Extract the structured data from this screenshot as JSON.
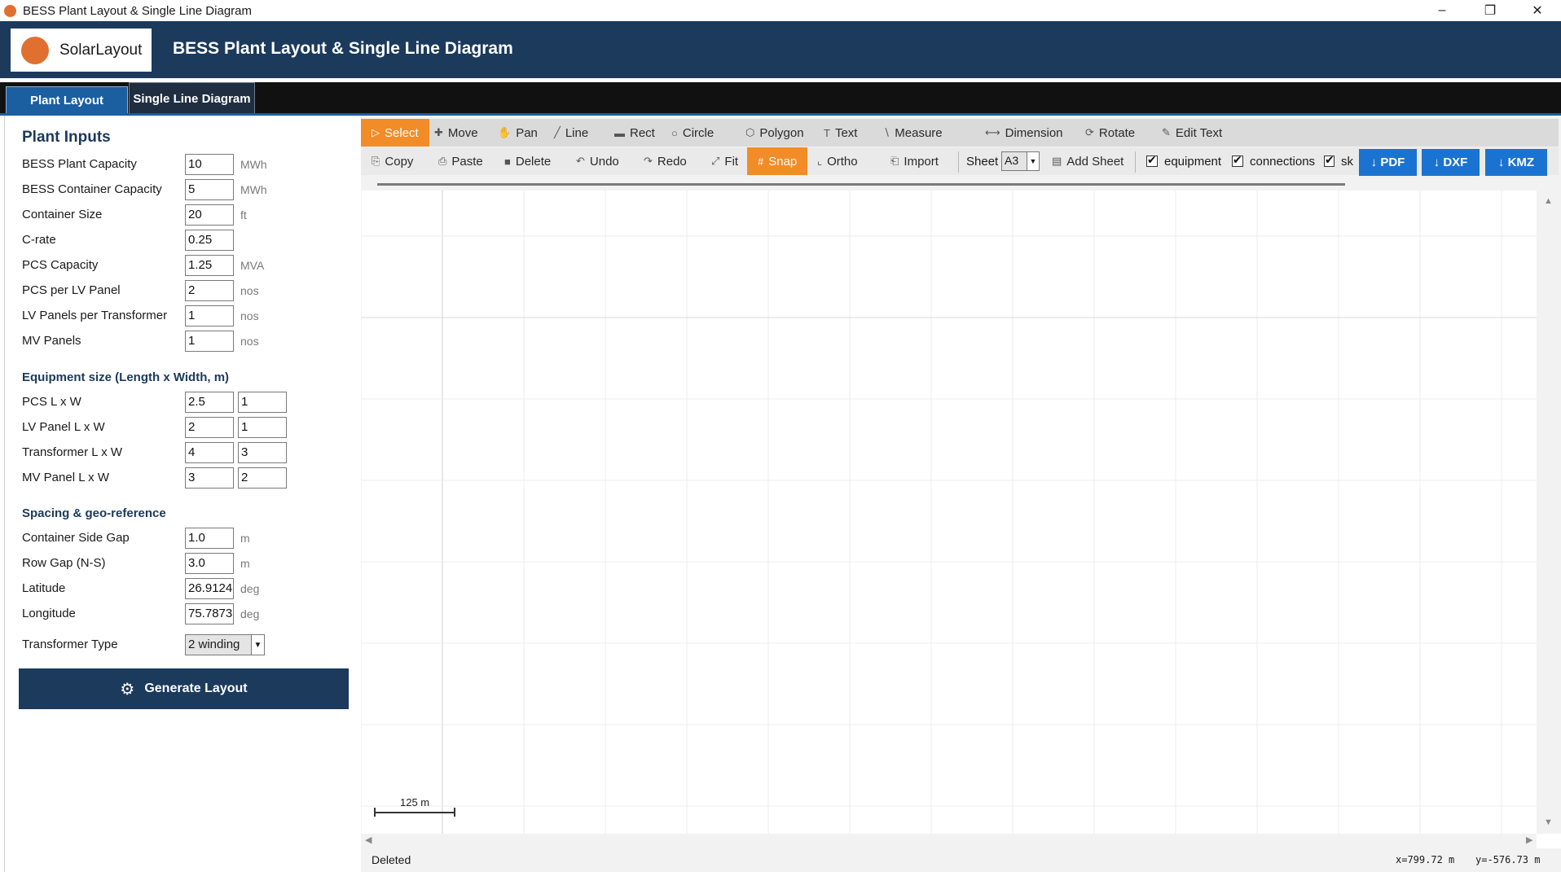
{
  "window": {
    "title": "BESS Plant Layout & Single Line Diagram",
    "minimize": "–",
    "maximize": "❐",
    "close": "✕"
  },
  "header": {
    "logo_text": "SolarLayout",
    "title": "BESS Plant Layout & Single Line Diagram"
  },
  "tabs": [
    {
      "label": "Plant Layout",
      "active": true
    },
    {
      "label": "Single Line Diagram",
      "active": false
    }
  ],
  "left": {
    "plant_inputs_title": "Plant Inputs",
    "plant_inputs": [
      {
        "label": "BESS Plant Capacity",
        "value": "10",
        "unit": "MWh"
      },
      {
        "label": "BESS Container Capacity",
        "value": "5",
        "unit": "MWh"
      },
      {
        "label": "Container Size",
        "value": "20",
        "unit": "ft"
      },
      {
        "label": "C-rate",
        "value": "0.25",
        "unit": ""
      },
      {
        "label": "PCS Capacity",
        "value": "1.25",
        "unit": "MVA"
      },
      {
        "label": "PCS per LV Panel",
        "value": "2",
        "unit": "nos"
      },
      {
        "label": "LV Panels per Transformer",
        "value": "1",
        "unit": "nos"
      },
      {
        "label": "MV Panels",
        "value": "1",
        "unit": "nos"
      }
    ],
    "equip_title": "Equipment size  (Length x Width, m)",
    "equipment": [
      {
        "label": "PCS  L x W",
        "length": "2.5",
        "width": "1"
      },
      {
        "label": "LV Panel  L x W",
        "length": "2",
        "width": "1"
      },
      {
        "label": "Transformer  L x W",
        "length": "4",
        "width": "3"
      },
      {
        "label": "MV Panel  L x W",
        "length": "3",
        "width": "2"
      }
    ],
    "spacing_title": "Spacing & geo-reference",
    "spacing": [
      {
        "label": "Container Side Gap",
        "value": "1.0",
        "unit": "m"
      },
      {
        "label": "Row Gap (N-S)",
        "value": "3.0",
        "unit": "m"
      },
      {
        "label": "Latitude",
        "value": "26.9124",
        "unit": "deg"
      },
      {
        "label": "Longitude",
        "value": "75.7873",
        "unit": "deg"
      }
    ],
    "transformer_type_label": "Transformer Type",
    "transformer_type_value": "2 winding",
    "generate_label": "Generate Layout"
  },
  "toolbar1": [
    {
      "label": "Select",
      "icon": "▷",
      "name": "select",
      "active": true
    },
    {
      "label": "Move",
      "icon": "✚",
      "name": "move"
    },
    {
      "label": "Pan",
      "icon": "✋",
      "name": "pan"
    },
    {
      "label": "Line",
      "icon": "╱",
      "name": "line"
    },
    {
      "label": "Rect",
      "icon": "▬",
      "name": "rect"
    },
    {
      "label": "Circle",
      "icon": "○",
      "name": "circle"
    },
    {
      "label": "Polygon",
      "icon": "⬡",
      "name": "polygon"
    },
    {
      "label": "Text",
      "icon": "T",
      "name": "text"
    },
    {
      "label": "Measure",
      "icon": "∖",
      "name": "measure"
    },
    {
      "label": "Dimension",
      "icon": "⟷",
      "name": "dimension"
    },
    {
      "label": "Rotate",
      "icon": "⟳",
      "name": "rotate"
    },
    {
      "label": "Edit Text",
      "icon": "✎",
      "name": "edit-text"
    }
  ],
  "toolbar2": [
    {
      "label": "Copy",
      "icon": "⎘",
      "name": "copy"
    },
    {
      "label": "Paste",
      "icon": "⎙",
      "name": "paste"
    },
    {
      "label": "Delete",
      "icon": "■",
      "name": "delete"
    },
    {
      "label": "Undo",
      "icon": "↶",
      "name": "undo"
    },
    {
      "label": "Redo",
      "icon": "↷",
      "name": "redo"
    },
    {
      "label": "Fit",
      "icon": "⤢",
      "name": "fit"
    },
    {
      "label": "Snap",
      "icon": "#",
      "name": "snap",
      "active": true
    },
    {
      "label": "Ortho",
      "icon": "⌞",
      "name": "ortho"
    },
    {
      "label": "Import",
      "icon": "⎗",
      "name": "import"
    }
  ],
  "sheet": {
    "label": "Sheet",
    "value": "A3",
    "add_label": "Add Sheet",
    "add_icon": "▤"
  },
  "layers": [
    {
      "label": "equipment",
      "checked": true
    },
    {
      "label": "connections",
      "checked": true
    },
    {
      "label": "sk",
      "checked": true
    }
  ],
  "downloads": [
    {
      "label": "↓ PDF"
    },
    {
      "label": "↓ DXF"
    },
    {
      "label": "↓ KMZ"
    }
  ],
  "canvas": {
    "scale_label": "125 m"
  },
  "status": {
    "message": "Deleted",
    "x": "x=799.72 m",
    "y": "y=-576.73 m"
  },
  "colors": {
    "header": "#1b3a5c",
    "accent": "#f28c28",
    "download": "#1a73d1",
    "tab_active": "#1b5fa0",
    "logo": "#e07030"
  }
}
